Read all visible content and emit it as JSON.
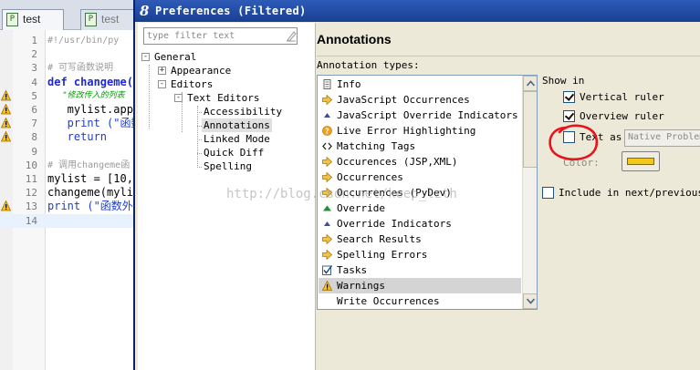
{
  "editor": {
    "tabs": [
      {
        "label": "test",
        "active": true
      },
      {
        "label": "test",
        "active": false
      }
    ],
    "lines": [
      {
        "num": "1",
        "text": "#!/usr/bin/py",
        "style": "cm",
        "warn": false
      },
      {
        "num": "2",
        "text": "",
        "style": "pl",
        "warn": false
      },
      {
        "num": "3",
        "text": "# 可写函数说明",
        "style": "cm",
        "warn": false
      },
      {
        "num": "4",
        "text": "def changeme(",
        "style": "kw",
        "warn": false
      },
      {
        "num": "5",
        "text": "   \"修改传入的列表",
        "style": "st",
        "warn": true
      },
      {
        "num": "6",
        "text": "   mylist.app",
        "style": "pl",
        "warn": true
      },
      {
        "num": "7",
        "text": "   print (\"函数",
        "style": "blue",
        "warn": true
      },
      {
        "num": "8",
        "text": "   return",
        "style": "blue",
        "warn": true
      },
      {
        "num": "9",
        "text": "",
        "style": "pl",
        "warn": false
      },
      {
        "num": "10",
        "text": "# 调用changeme函",
        "style": "cm",
        "warn": false
      },
      {
        "num": "11",
        "text": "mylist = [10,",
        "style": "pl",
        "warn": false
      },
      {
        "num": "12",
        "text": "changeme(myli",
        "style": "pl",
        "warn": false
      },
      {
        "num": "13",
        "text": "print (\"函数外取",
        "style": "blue",
        "warn": true
      },
      {
        "num": "14",
        "text": "",
        "style": "pl",
        "warn": false
      }
    ]
  },
  "dialog": {
    "title": "Preferences (Filtered)",
    "app_icon": "8",
    "filter_placeholder": "type filter text",
    "tree": [
      {
        "label": "General",
        "toggle": "-"
      },
      {
        "label": "Appearance",
        "toggle": "+"
      },
      {
        "label": "Editors",
        "toggle": "-"
      },
      {
        "label": "Text Editors",
        "toggle": "-"
      },
      {
        "label": "Accessibility",
        "toggle": ""
      },
      {
        "label": "Annotations",
        "toggle": "",
        "selected": true
      },
      {
        "label": "Linked Mode",
        "toggle": ""
      },
      {
        "label": "Quick Diff",
        "toggle": ""
      },
      {
        "label": "Spelling",
        "toggle": ""
      }
    ],
    "page_title": "Annotations",
    "types_label": "Annotation types:",
    "annotation_types": [
      {
        "label": "Info",
        "icon": "info-icon"
      },
      {
        "label": "JavaScript Occurrences",
        "icon": "arrow-right-icon"
      },
      {
        "label": "JavaScript Override Indicators",
        "icon": "triangle-up-icon"
      },
      {
        "label": "Live Error Highlighting",
        "icon": "question-icon"
      },
      {
        "label": "Matching Tags",
        "icon": "tag-brackets-icon"
      },
      {
        "label": "Occurences (JSP,XML)",
        "icon": "arrow-right-icon"
      },
      {
        "label": "Occurrences",
        "icon": "arrow-right-icon"
      },
      {
        "label": "Occurrences (PyDev)",
        "icon": "arrow-right-icon"
      },
      {
        "label": "Override",
        "icon": "triangle-green-icon"
      },
      {
        "label": "Override Indicators",
        "icon": "triangle-up-icon"
      },
      {
        "label": "Search Results",
        "icon": "arrow-right-icon"
      },
      {
        "label": "Spelling Errors",
        "icon": "arrow-right-icon"
      },
      {
        "label": "Tasks",
        "icon": "checkbox-task-icon"
      },
      {
        "label": "Warnings",
        "icon": "warning-icon",
        "selected": true
      },
      {
        "label": "Write Occurrences",
        "icon": ""
      }
    ],
    "show_in_label": "Show in",
    "vertical_ruler_label": "Vertical ruler",
    "overview_ruler_label": "Overview ruler",
    "text_as_label": "Text as",
    "text_as_value": "Native Problem",
    "color_label": "Color:",
    "color_value": "#f5c71a",
    "include_label": "Include in next/previous na",
    "vertical_ruler_checked": true,
    "overview_ruler_checked": true,
    "text_checked": false,
    "include_checked": false
  },
  "watermark": "http://blog.csdn.net/keep_lzth",
  "colors": {
    "titlebar": "#2e5bb8",
    "dialog_bg": "#ece9d8",
    "selection": "#d4d4d4",
    "annotation_color": "#f5c71a",
    "highlight_circle": "#e8141b"
  }
}
